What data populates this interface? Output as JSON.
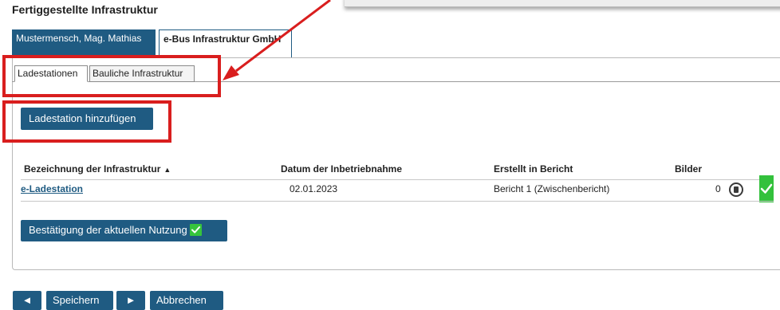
{
  "section_title": "Fertiggestellte Infrastruktur",
  "person_tabs": [
    "Mustermensch, Mag. Mathias",
    "e-Bus Infrastruktur GmbH"
  ],
  "sub_tabs": [
    "Ladestationen",
    "Bauliche Infrastruktur"
  ],
  "add_button": "Ladestation hinzufügen",
  "table": {
    "headers": [
      "Bezeichnung der Infrastruktur",
      "Datum der Inbetriebnahme",
      "Erstellt in Bericht",
      "Bilder"
    ],
    "sort_indicator": "▲",
    "row": {
      "name": "e-Ladestation",
      "date": "02.01.2023",
      "report": "Bericht 1 (Zwischenbericht)",
      "images": "0"
    }
  },
  "confirm_button": "Bestätigung der aktuellen Nutzung",
  "footer": {
    "prev": "◄",
    "save": "Speichern",
    "next": "►",
    "cancel": "Abbrechen"
  },
  "colors": {
    "primary": "#1f5b82",
    "highlight": "#d91e1e",
    "success": "#36c43c"
  },
  "icons": [
    "check-icon",
    "trash-icon",
    "triangle-left-icon",
    "triangle-right-icon"
  ]
}
